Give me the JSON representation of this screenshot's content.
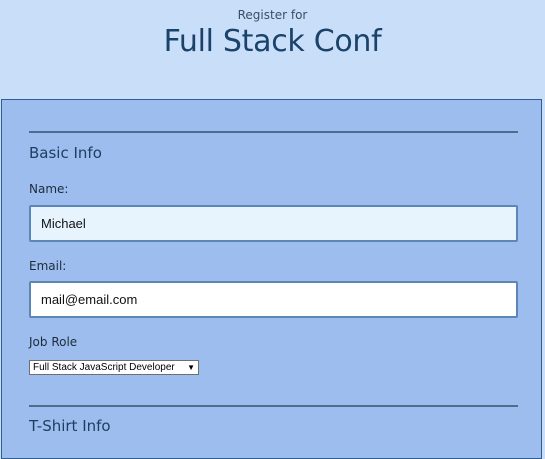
{
  "header": {
    "pretitle": "Register for",
    "title": "Full Stack Conf"
  },
  "basic_info": {
    "section_title": "Basic Info",
    "name_label": "Name:",
    "name_value": "Michael",
    "email_label": "Email:",
    "email_value": "mail@email.com",
    "job_role_label": "Job Role",
    "job_role_selected": "Full Stack JavaScript Developer"
  },
  "tshirt_info": {
    "section_title": "T-Shirt Info"
  },
  "icons": {
    "dropdown": "chevron-down-icon"
  },
  "colors": {
    "page_background": "#c9def9",
    "form_background": "#9cbdee",
    "title": "#1b4268",
    "input_border": "#5d86b8"
  }
}
